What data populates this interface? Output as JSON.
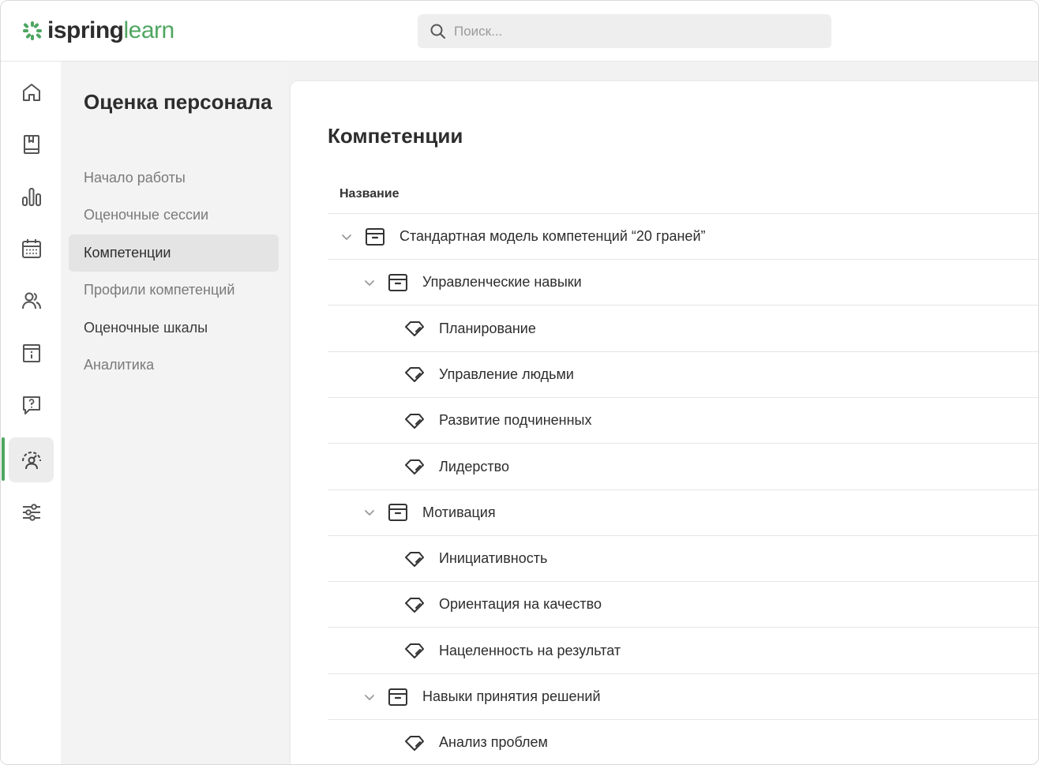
{
  "header": {
    "logo_primary": "ispring",
    "logo_secondary": "learn",
    "search_placeholder": "Поиск..."
  },
  "rail": {
    "items": [
      {
        "icon": "home-icon"
      },
      {
        "icon": "book-icon"
      },
      {
        "icon": "bar-chart-icon"
      },
      {
        "icon": "calendar-icon"
      },
      {
        "icon": "users-icon"
      },
      {
        "icon": "info-card-icon"
      },
      {
        "icon": "question-chat-icon"
      },
      {
        "icon": "assessment-gauge-icon",
        "active": true
      },
      {
        "icon": "settings-sliders-icon"
      }
    ]
  },
  "subnav": {
    "title": "Оценка персонала",
    "items": [
      {
        "label": "Начало работы"
      },
      {
        "label": "Оценочные сессии"
      },
      {
        "label": "Компетенции",
        "active": true
      },
      {
        "label": "Профили компетенций"
      },
      {
        "label": "Оценочные шкалы"
      },
      {
        "label": "Аналитика"
      }
    ]
  },
  "main": {
    "title": "Компетенции",
    "column_header": "Название",
    "rows": [
      {
        "label": "Стандартная модель компетенций “20 граней”",
        "type": "folder",
        "level": 0
      },
      {
        "label": "Управленческие навыки",
        "type": "folder",
        "level": 1
      },
      {
        "label": "Планирование",
        "type": "competency",
        "level": 2
      },
      {
        "label": "Управление людьми",
        "type": "competency",
        "level": 2
      },
      {
        "label": "Развитие подчиненных",
        "type": "competency",
        "level": 2
      },
      {
        "label": "Лидерство",
        "type": "competency",
        "level": 2
      },
      {
        "label": "Мотивация",
        "type": "folder",
        "level": 1
      },
      {
        "label": "Инициативность",
        "type": "competency",
        "level": 2
      },
      {
        "label": "Ориентация на качество",
        "type": "competency",
        "level": 2
      },
      {
        "label": "Нацеленность на результат",
        "type": "competency",
        "level": 2
      },
      {
        "label": "Навыки принятия решений",
        "type": "folder",
        "level": 1
      },
      {
        "label": "Анализ проблем",
        "type": "competency",
        "level": 2
      }
    ]
  },
  "colors": {
    "accent": "#4fa661",
    "text": "#2d2d2d",
    "muted": "#7a7a7a"
  }
}
